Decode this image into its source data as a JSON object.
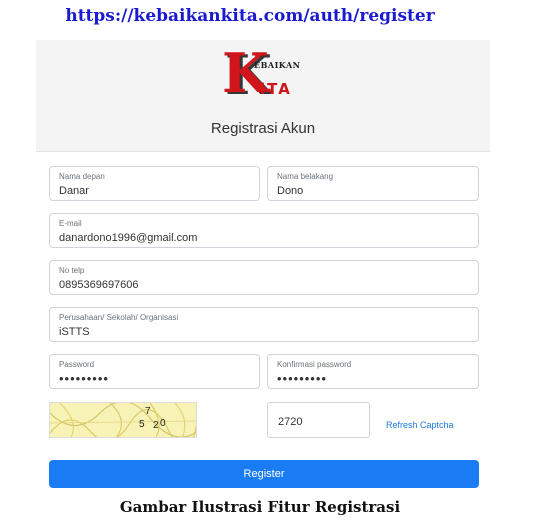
{
  "url_caption": "https://kebaikankita.com/auth/register",
  "logo": {
    "letter_k": "K",
    "top_text": "EBAIKAN",
    "bottom_text": "iTA"
  },
  "page_title": "Registrasi Akun",
  "fields": {
    "first_name": {
      "label": "Nama depan",
      "value": "Danar"
    },
    "last_name": {
      "label": "Nama belakang",
      "value": "Dono"
    },
    "email": {
      "label": "E-mail",
      "value": "danardono1996@gmail.com"
    },
    "phone": {
      "label": "No telp",
      "value": "0895369697606"
    },
    "organization": {
      "label": "Perusahaan/ Sekolah/ Organisasi",
      "value": "iSTTS"
    },
    "password": {
      "label": "Password",
      "value": "•••••••••"
    },
    "confirm_password": {
      "label": "Konfirmasi password",
      "value": "•••••••••"
    }
  },
  "captcha": {
    "digits": [
      "7",
      "5",
      "2",
      "0"
    ],
    "input_value": "2720",
    "refresh_label": "Refresh Captcha"
  },
  "register_label": "Register",
  "figure_caption": "Gambar Ilustrasi Fitur Registrasi",
  "colors": {
    "url": "#1a1ad0",
    "logo_red": "#d0161b",
    "button_blue": "#1a7cf5",
    "link_blue": "#1e7be0",
    "captcha_bg": "#f7f2b5"
  }
}
